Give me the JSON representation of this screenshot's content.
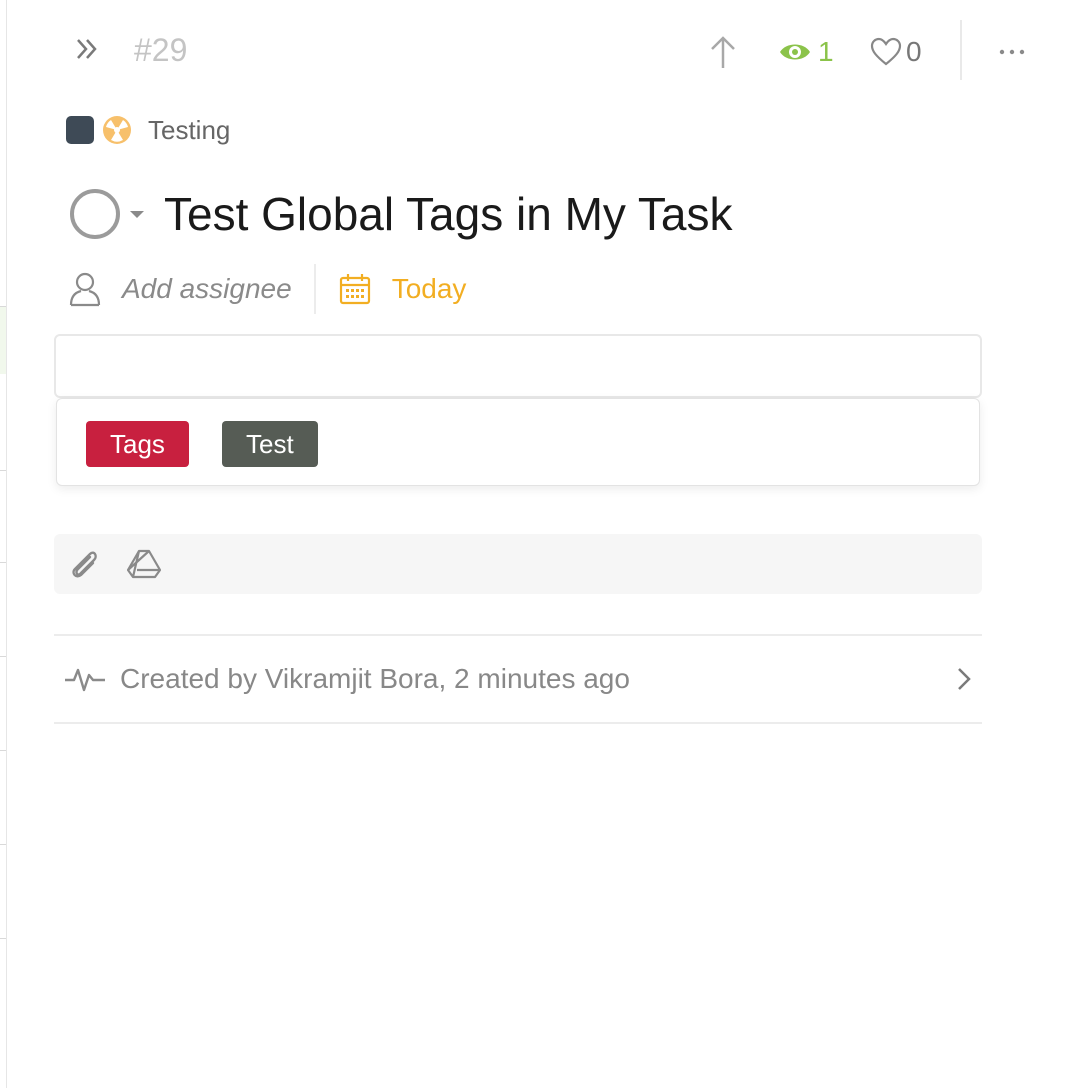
{
  "header": {
    "task_number": "#29",
    "watchers_count": "1",
    "likes_count": "0"
  },
  "project": {
    "name": "Testing",
    "color": "#3e4a56",
    "emoji": "radioactive-emoji-icon"
  },
  "task": {
    "title": "Test Global Tags in My Task"
  },
  "meta": {
    "assignee_placeholder": "Add assignee",
    "due_label": "Today"
  },
  "tags": {
    "input_value": "",
    "options": [
      {
        "label": "Tags",
        "color": "#c8203f"
      },
      {
        "label": "Test",
        "color": "#565c55"
      }
    ]
  },
  "attachments": {
    "icons": [
      "paperclip-icon",
      "google-drive-icon"
    ]
  },
  "activity": {
    "text": "Created by Vikramjit Bora, 2 minutes ago"
  },
  "colors": {
    "accent_green": "#8bc34a",
    "due_yellow": "#f2ae22"
  }
}
